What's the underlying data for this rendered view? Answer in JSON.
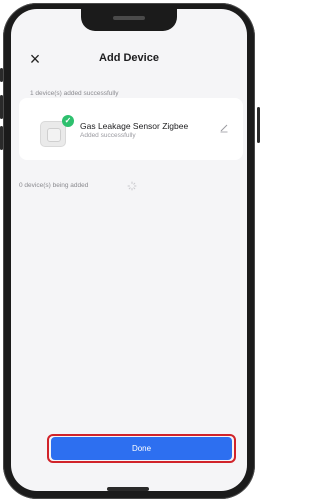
{
  "header": {
    "title": "Add Device",
    "close_icon": "×"
  },
  "added": {
    "summary": "1 device(s) added successfully",
    "device": {
      "name": "Gas Leakage Sensor Zigbee",
      "status": "Added successfully",
      "badge_icon": "✓"
    }
  },
  "pending": {
    "summary": "0 device(s) being added"
  },
  "actions": {
    "done_label": "Done"
  },
  "colors": {
    "primary": "#2d6ff0",
    "success": "#2ec06e",
    "highlight_outline": "#d1232a",
    "screen_background": "#f5f5f7"
  }
}
